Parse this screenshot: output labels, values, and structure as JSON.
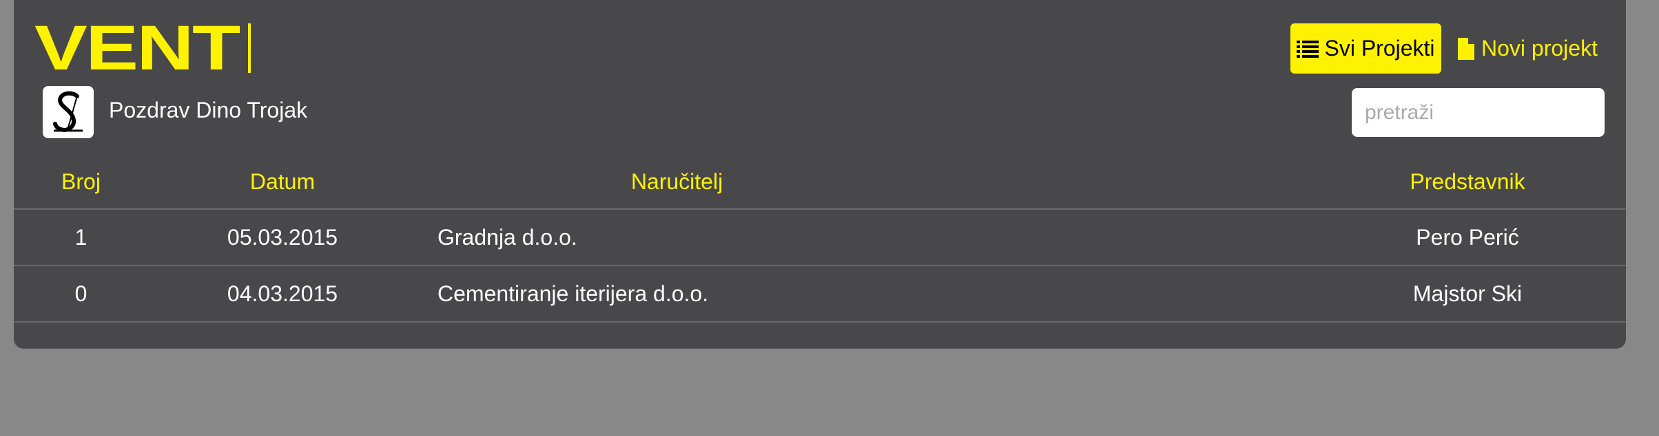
{
  "app": {
    "logo_text": "VENT",
    "greeting": "Pozdrav Dino Trojak",
    "avatar_icon": "s-logo-icon"
  },
  "nav": {
    "all_projects": {
      "label": "Svi Projekti",
      "icon": "list-icon"
    },
    "new_project": {
      "label": "Novi projekt",
      "icon": "file-icon"
    }
  },
  "search": {
    "placeholder": "pretraži",
    "value": ""
  },
  "table": {
    "headers": {
      "broj": "Broj",
      "datum": "Datum",
      "narucitelj": "Naručitelj",
      "predstavnik": "Predstavnik"
    },
    "rows": [
      {
        "broj": "1",
        "datum": "05.03.2015",
        "narucitelj": "Gradnja d.o.o.",
        "predstavnik": "Pero Perić"
      },
      {
        "broj": "0",
        "datum": "04.03.2015",
        "narucitelj": "Cementiranje iterijera d.o.o.",
        "predstavnik": "Majstor Ski"
      }
    ]
  },
  "colors": {
    "accent": "#fff200",
    "panel": "#48484a",
    "background": "#888888"
  }
}
